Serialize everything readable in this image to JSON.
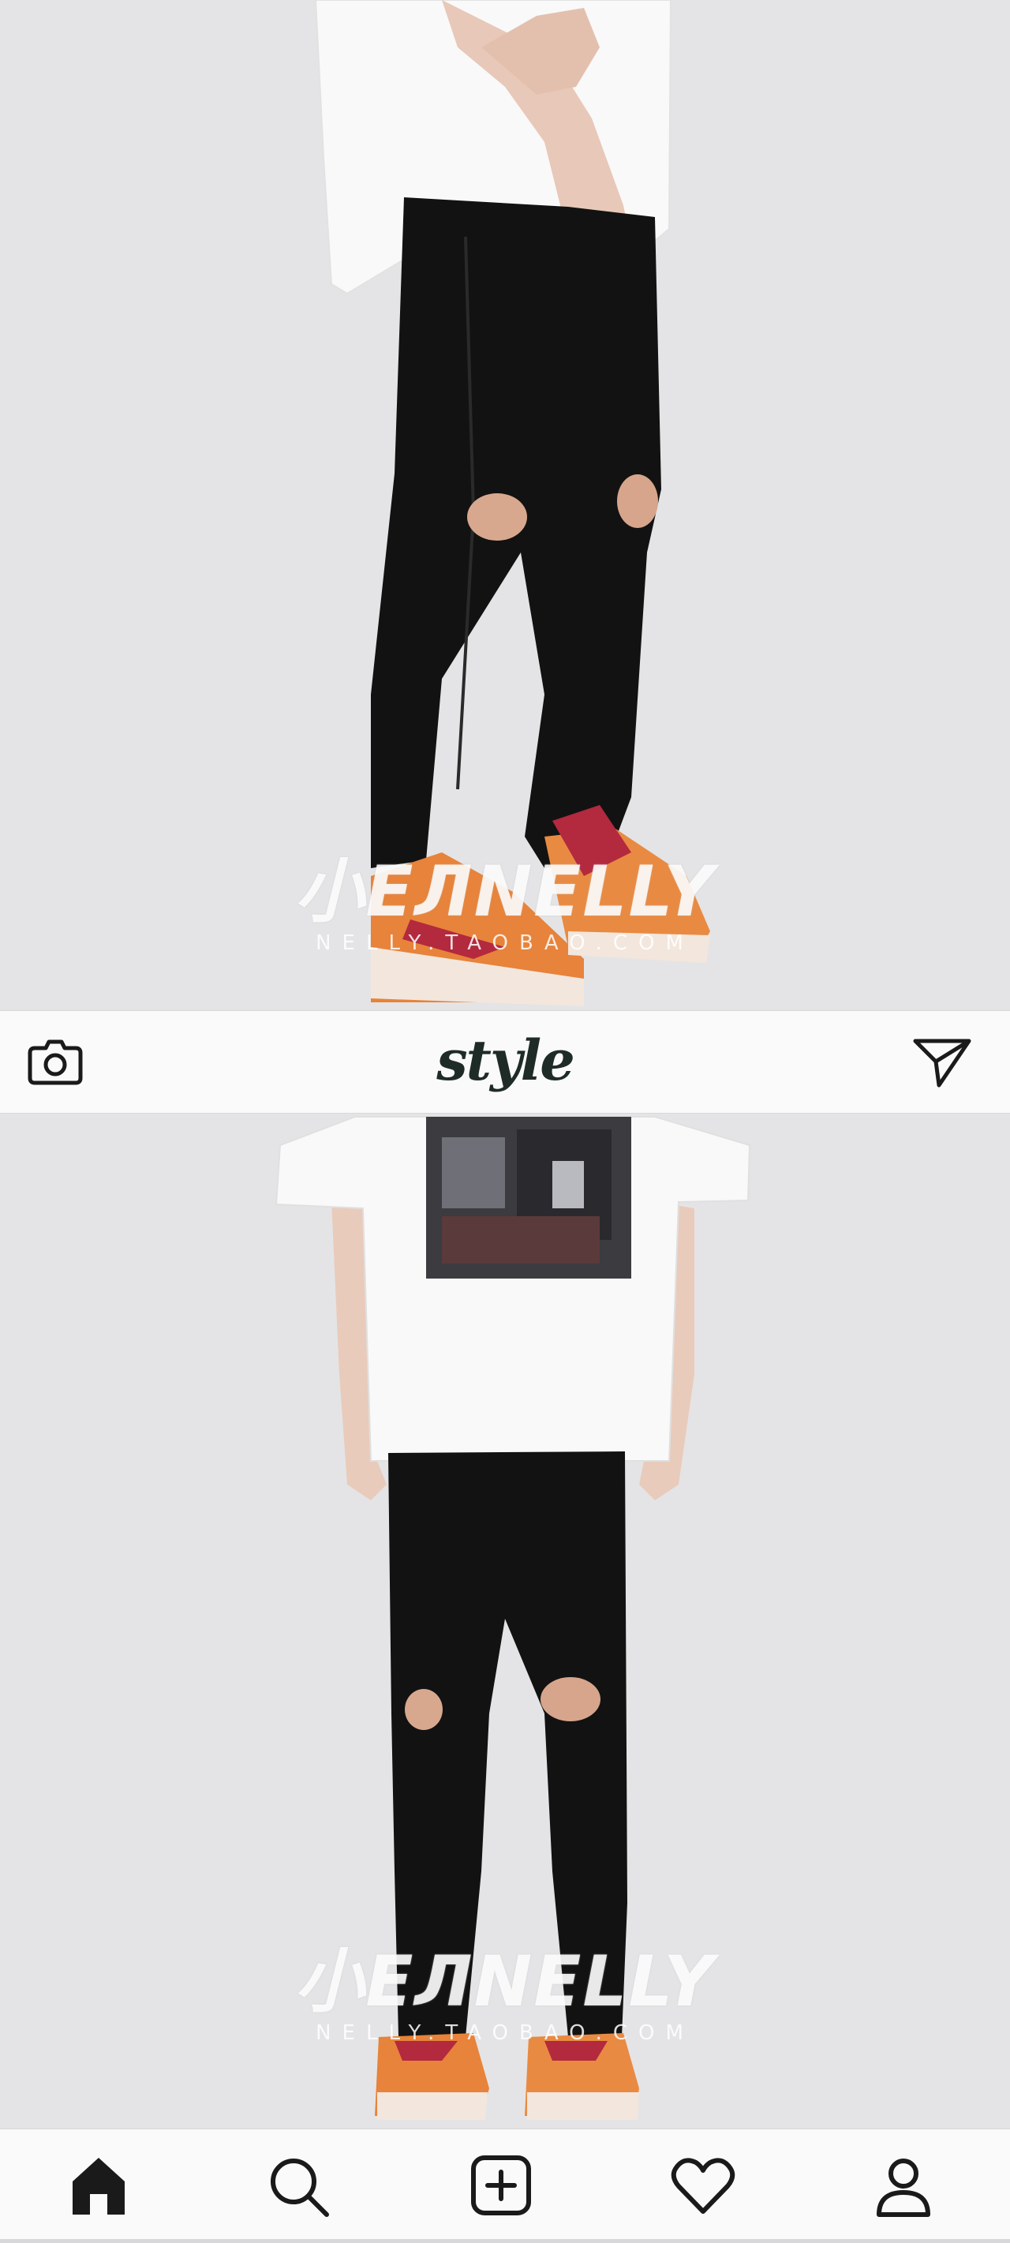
{
  "header": {
    "logo": "style",
    "camera_icon": "camera-icon",
    "send_icon": "send-icon"
  },
  "posts": [
    {
      "watermark_main": "小ЕЛNELLY",
      "watermark_sub": "NELLY.TAOBAO.COM"
    },
    {
      "watermark_main": "小ЕЛNELLY",
      "watermark_sub": "NELLY.TAOBAO.COM"
    }
  ],
  "tabbar": {
    "items": [
      {
        "icon": "home-icon"
      },
      {
        "icon": "search-icon"
      },
      {
        "icon": "add-icon"
      },
      {
        "icon": "heart-icon"
      },
      {
        "icon": "profile-icon"
      }
    ]
  },
  "colors": {
    "bar_bg": "#fafafa",
    "icon": "#1a1a1a",
    "logo": "#1f2b27",
    "photo_bg": "#e4e4e6"
  }
}
